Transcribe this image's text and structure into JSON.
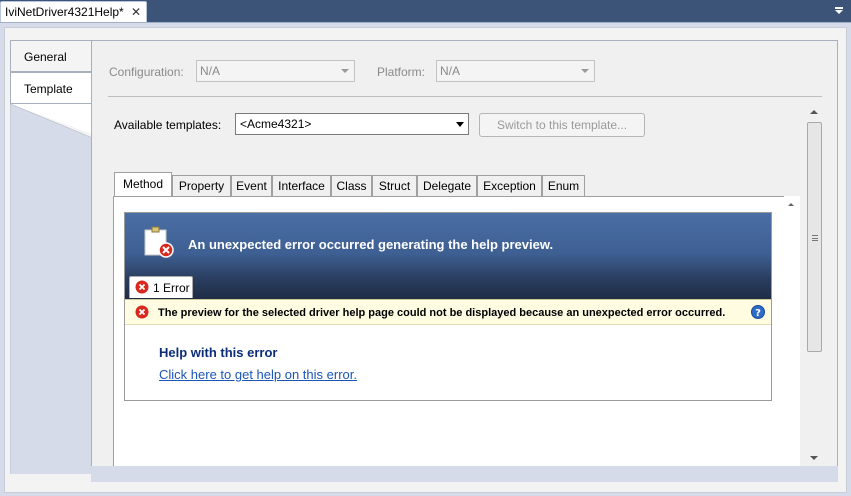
{
  "document_tab": {
    "title": "IviNetDriver4321Help*",
    "close_glyph": "✕"
  },
  "side_tabs": [
    {
      "label": "General"
    },
    {
      "label": "Template"
    }
  ],
  "config": {
    "configuration_label": "Configuration:",
    "configuration_value": "N/A",
    "platform_label": "Platform:",
    "platform_value": "N/A"
  },
  "templates": {
    "label": "Available templates:",
    "selected": "<Acme4321>",
    "switch_button": "Switch to this template..."
  },
  "template_tabs": [
    {
      "label": "Method"
    },
    {
      "label": "Property"
    },
    {
      "label": "Event"
    },
    {
      "label": "Interface"
    },
    {
      "label": "Class"
    },
    {
      "label": "Struct"
    },
    {
      "label": "Delegate"
    },
    {
      "label": "Exception"
    },
    {
      "label": "Enum"
    }
  ],
  "preview": {
    "banner_title": "An unexpected error occurred generating the help preview.",
    "error_tab": "1 Error",
    "error_message": "The preview for the selected driver help page could not be displayed because an unexpected error occurred.",
    "help_title": "Help with this error",
    "help_link": "Click here to get help on this error."
  },
  "colors": {
    "banner": "#3e5f92",
    "error_bar": "#fffce1",
    "help_title": "#0d2d79",
    "link": "#1a56b8",
    "error_icon": "#d8281e"
  }
}
